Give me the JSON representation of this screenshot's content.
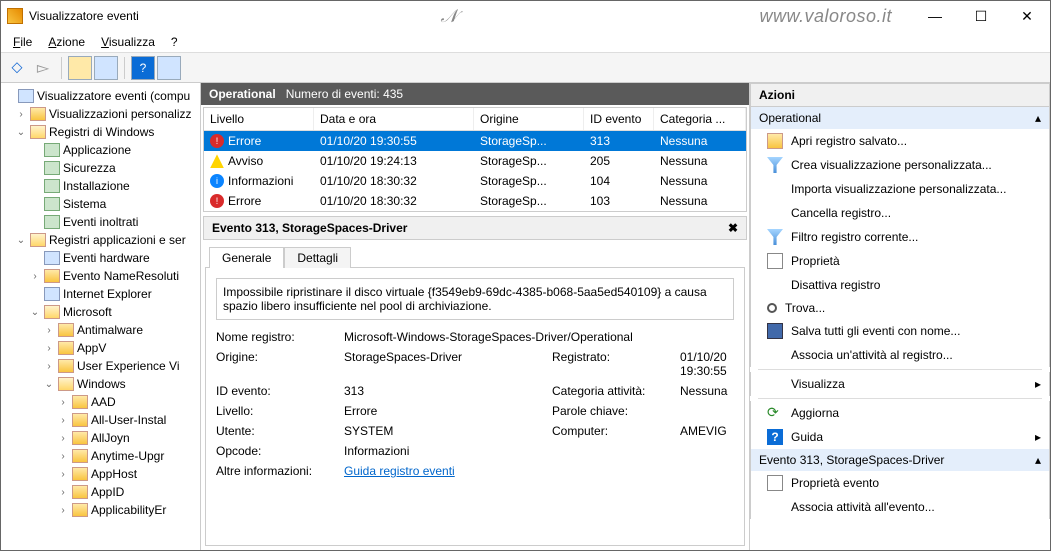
{
  "window": {
    "title": "Visualizzatore eventi",
    "watermark_url": "www.valoroso.it"
  },
  "menu": {
    "file": "File",
    "action": "Azione",
    "view": "Visualizza",
    "help": "?"
  },
  "tree": {
    "root": "Visualizzatore eventi (compu",
    "custom_views": "Visualizzazioni personalizz",
    "win_logs": "Registri di Windows",
    "win_logs_items": [
      "Applicazione",
      "Sicurezza",
      "Installazione",
      "Sistema",
      "Eventi inoltrati"
    ],
    "app_logs": "Registri applicazioni e ser",
    "hw_events": "Eventi hardware",
    "name_res": "Evento NameResoluti",
    "ie": "Internet Explorer",
    "microsoft": "Microsoft",
    "ms_items": [
      "Antimalware",
      "AppV",
      "User Experience Vi",
      "Windows"
    ],
    "win_sub": [
      "AAD",
      "All-User-Instal",
      "AllJoyn",
      "Anytime-Upgr",
      "AppHost",
      "AppID",
      "ApplicabilityEr"
    ]
  },
  "center": {
    "title": "Operational",
    "count_label": "Numero di eventi: 435",
    "cols": {
      "level": "Livello",
      "date": "Data e ora",
      "source": "Origine",
      "id": "ID evento",
      "cat": "Categoria ..."
    },
    "rows": [
      {
        "lv": "err",
        "level": "Errore",
        "date": "01/10/20 19:30:55",
        "source": "StorageSp...",
        "id": "313",
        "cat": "Nessuna",
        "sel": true
      },
      {
        "lv": "warn",
        "level": "Avviso",
        "date": "01/10/20 19:24:13",
        "source": "StorageSp...",
        "id": "205",
        "cat": "Nessuna"
      },
      {
        "lv": "info",
        "level": "Informazioni",
        "date": "01/10/20 18:30:32",
        "source": "StorageSp...",
        "id": "104",
        "cat": "Nessuna"
      },
      {
        "lv": "err",
        "level": "Errore",
        "date": "01/10/20 18:30:32",
        "source": "StorageSp...",
        "id": "103",
        "cat": "Nessuna"
      }
    ]
  },
  "detail": {
    "header": "Evento 313, StorageSpaces-Driver",
    "tab_general": "Generale",
    "tab_details": "Dettagli",
    "message": "Impossibile ripristinare il disco virtuale {f3549eb9-69dc-4385-b068-5aa5ed540109} a causa spazio libero insufficiente nel pool di archiviazione.",
    "props": {
      "logname_l": "Nome registro:",
      "logname_v": "Microsoft-Windows-StorageSpaces-Driver/Operational",
      "source_l": "Origine:",
      "source_v": "StorageSpaces-Driver",
      "logged_l": "Registrato:",
      "logged_v": "01/10/20 19:30:55",
      "id_l": "ID evento:",
      "id_v": "313",
      "cat_l": "Categoria attività:",
      "cat_v": "Nessuna",
      "level_l": "Livello:",
      "level_v": "Errore",
      "kw_l": "Parole chiave:",
      "kw_v": "",
      "user_l": "Utente:",
      "user_v": "SYSTEM",
      "comp_l": "Computer:",
      "comp_v": "AMEVIG",
      "opcode_l": "Opcode:",
      "opcode_v": "Informazioni",
      "more_l": "Altre informazioni:",
      "more_v": "Guida registro eventi"
    }
  },
  "actions": {
    "title": "Azioni",
    "sec1": "Operational",
    "items1": [
      "Apri registro salvato...",
      "Crea visualizzazione personalizzata...",
      "Importa visualizzazione personalizzata...",
      "Cancella registro...",
      "Filtro registro corrente...",
      "Proprietà",
      "Disattiva registro",
      "Trova...",
      "Salva tutti gli eventi con nome...",
      "Associa un'attività al registro...",
      "Visualizza",
      "Aggiorna",
      "Guida"
    ],
    "sec2": "Evento 313, StorageSpaces-Driver",
    "items2": [
      "Proprietà evento",
      "Associa attività all'evento..."
    ]
  }
}
